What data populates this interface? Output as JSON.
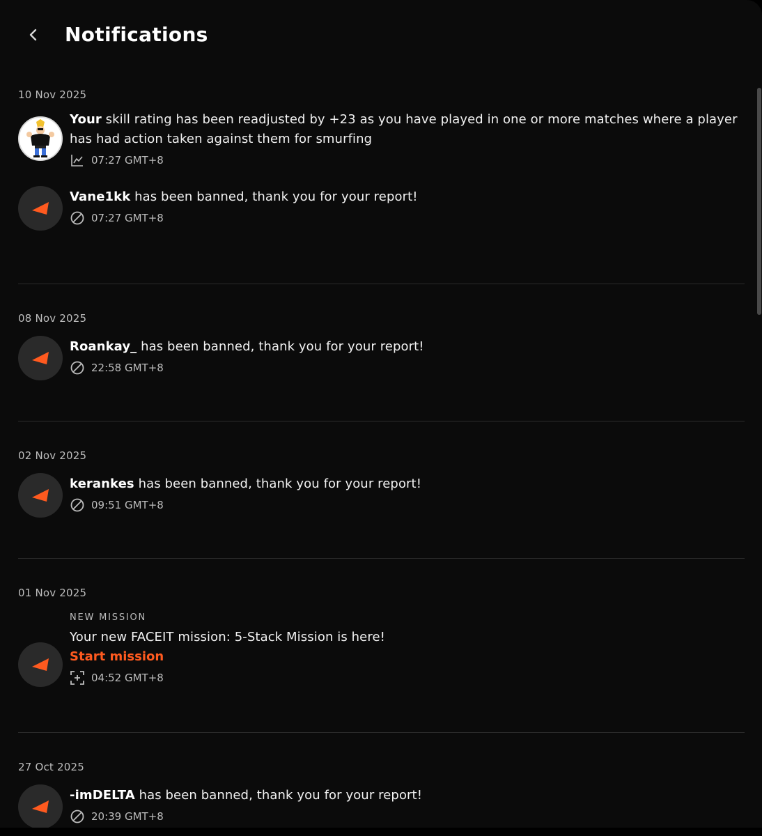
{
  "header": {
    "title": "Notifications"
  },
  "groups": [
    {
      "date": "10 Nov 2025",
      "items": [
        {
          "bold": "Your",
          "text": " skill rating has been readjusted by +23 as you have played in one or more matches where a player has had action taken against them for smurfing",
          "time": "07:27 GMT+8",
          "icon": "chart-line-icon",
          "avatar": "user-avatar"
        },
        {
          "bold": "Vane1kk",
          "text": " has been banned, thank you for your report!",
          "time": "07:27 GMT+8",
          "icon": "ban-icon",
          "avatar": "faceit-logo"
        }
      ]
    },
    {
      "date": "08 Nov 2025",
      "items": [
        {
          "bold": "Roankay_",
          "text": " has been banned, thank you for your report!",
          "time": "22:58 GMT+8",
          "icon": "ban-icon",
          "avatar": "faceit-logo"
        }
      ]
    },
    {
      "date": "02 Nov 2025",
      "items": [
        {
          "bold": "kerankes",
          "text": " has been banned, thank you for your report!",
          "time": "09:51 GMT+8",
          "icon": "ban-icon",
          "avatar": "faceit-logo"
        }
      ]
    },
    {
      "date": "01 Nov 2025",
      "items": [
        {
          "overline": "NEW MISSION",
          "text": "Your new FACEIT mission: 5-Stack Mission is here!",
          "cta": "Start mission",
          "time": "04:52 GMT+8",
          "icon": "mission-icon",
          "avatar": "faceit-logo"
        }
      ]
    },
    {
      "date": "27 Oct 2025",
      "items": [
        {
          "bold": "-imDELTA",
          "text": " has been banned, thank you for your report!",
          "time": "20:39 GMT+8",
          "icon": "ban-icon",
          "avatar": "faceit-logo"
        }
      ]
    }
  ],
  "colors": {
    "background": "#0b0b0b",
    "accent": "#ff5a1f",
    "muted_text": "#bdbdbd",
    "divider": "#2c2c2c",
    "avatar_bg": "#2a2a2a"
  }
}
